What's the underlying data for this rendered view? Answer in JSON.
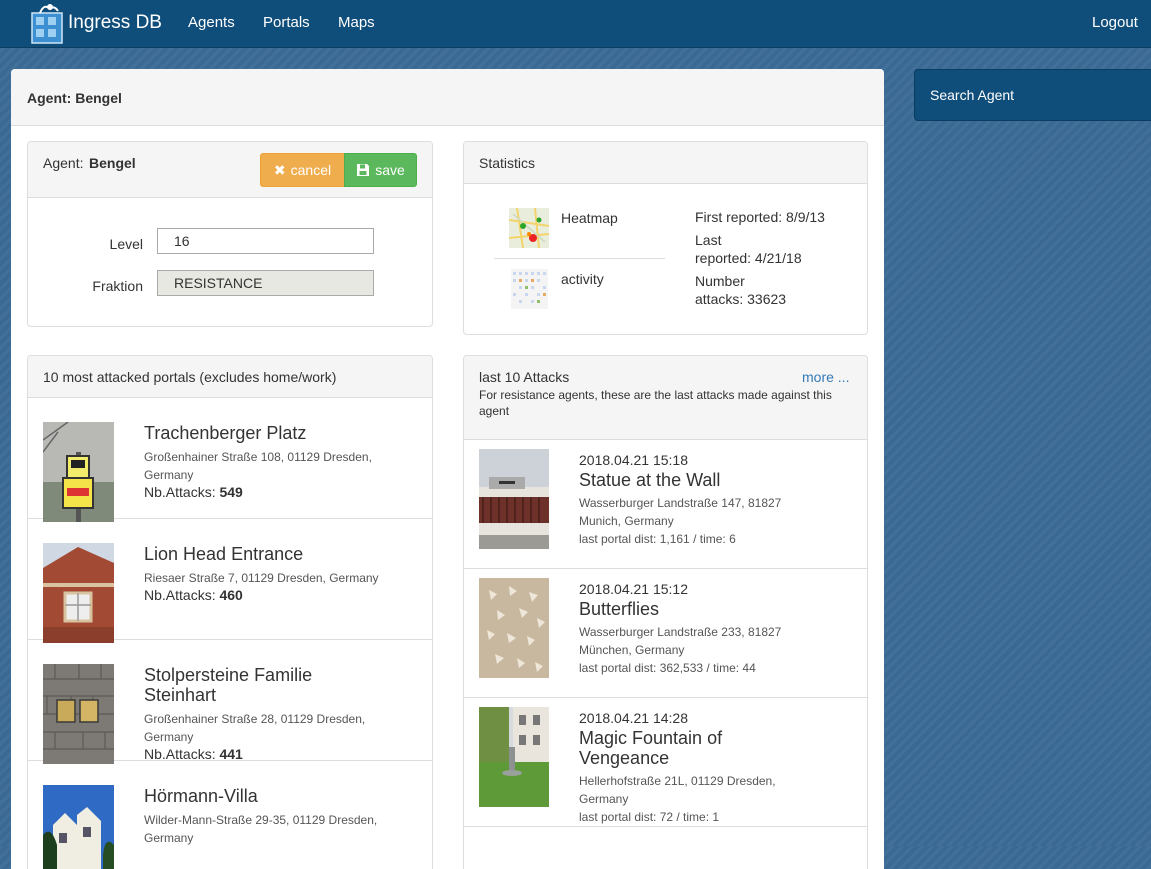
{
  "nav": {
    "brand": "Ingress DB",
    "links": [
      "Agents",
      "Portals",
      "Maps"
    ],
    "logout": "Logout"
  },
  "search": {
    "label": "Search Agent"
  },
  "agent_panel": {
    "heading_prefix": "Agent:",
    "heading_name": "Bengel"
  },
  "edit_card": {
    "title_prefix": "Agent:",
    "title_name": "Bengel",
    "cancel_label": "cancel",
    "save_label": "save",
    "level_label": "Level",
    "level_value": "16",
    "faction_label": "Fraktion",
    "faction_value": "RESISTANCE"
  },
  "stats_card": {
    "title": "Statistics",
    "heatmap_label": "Heatmap",
    "activity_label": "activity",
    "first_reported": "First reported: 8/9/13",
    "last_reported_1": "Last",
    "last_reported_2": "reported: 4/21/18",
    "attacks_1": "Number",
    "attacks_2": "attacks: 33623"
  },
  "portals_card": {
    "title": "10 most attacked portals (excludes home/work)",
    "count_label": "Nb.Attacks:",
    "items": [
      {
        "title": "Trachenberger Platz",
        "address": "Großenhainer Straße 108, 01129 Dresden, Germany",
        "count": "549",
        "photo": "bus-stop-sign"
      },
      {
        "title": "Lion Head Entrance",
        "address": "Riesaer Straße 7, 01129 Dresden, Germany",
        "count": "460",
        "photo": "brick-building"
      },
      {
        "title": "Stolpersteine Familie Steinhart",
        "address": "Großenhainer Straße 28, 01129 Dresden, Germany",
        "count": "441",
        "photo": "brass-stones"
      },
      {
        "title": "Hörmann-Villa",
        "address": "Wilder-Mann-Straße 29-35, 01129 Dresden, Germany",
        "count": "",
        "photo": "villa"
      }
    ]
  },
  "attacks_card": {
    "title": "last 10 Attacks",
    "more_link": "more ...",
    "subtitle": "For resistance agents, these are the last attacks made against this agent",
    "items": [
      {
        "time": "2018.04.21 15:18",
        "title": "Statue at the Wall",
        "address": "Wasserburger Landstraße 147, 81827 Munich, Germany",
        "dist": "last portal dist: 1,161 / time: 6",
        "photo": "wall"
      },
      {
        "time": "2018.04.21 15:12",
        "title": "Butterflies",
        "address": "Wasserburger Landstraße 233, 81827 München, Germany",
        "dist": "last portal dist: 362,533 / time: 44",
        "photo": "butterflies"
      },
      {
        "time": "2018.04.21 14:28",
        "title": "Magic Fountain of Vengeance",
        "address": "Hellerhofstraße 21L, 01129 Dresden, Germany",
        "dist": "last portal dist: 72 / time: 1",
        "photo": "fountain"
      }
    ]
  },
  "colors": {
    "navbar": "#0f4d7a",
    "background": "#3a6a94",
    "cancel": "#f0ad4e",
    "save": "#5cb85c",
    "link": "#337ab7"
  }
}
